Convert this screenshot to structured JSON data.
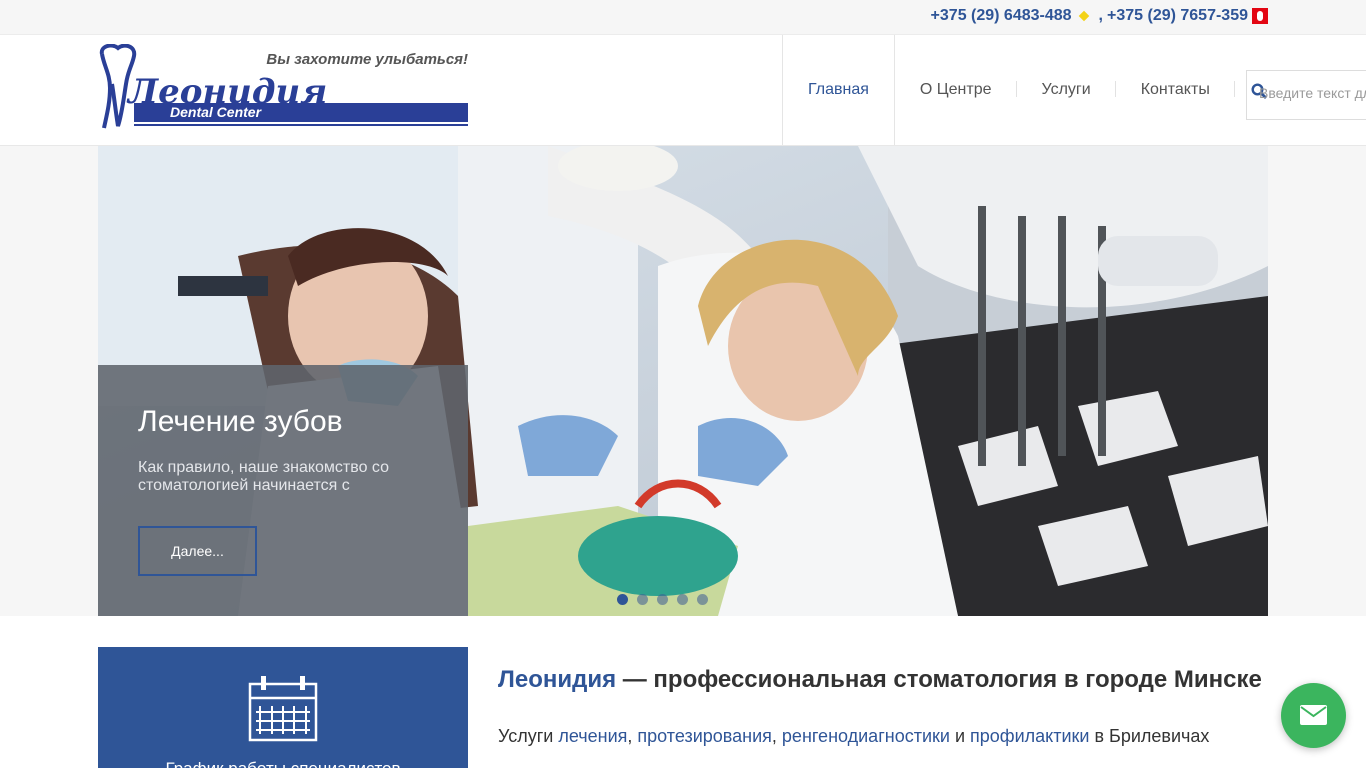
{
  "topbar": {
    "phone_1": "+375 (29) 6483-488",
    "separator": ",",
    "phone_2": "+375 (29) 7657-359",
    "operator_1_icon": "velcom-icon",
    "operator_2_icon": "mts-icon"
  },
  "logo": {
    "brand": "Леонидия",
    "subbrand": "Dental Center",
    "tagline": "Вы захотите улыбаться!",
    "brand_color": "#2a3f97"
  },
  "nav": {
    "items": [
      {
        "label": "Главная",
        "active": true
      },
      {
        "label": "О Центре",
        "active": false
      },
      {
        "label": "Услуги",
        "active": false
      },
      {
        "label": "Контакты",
        "active": false
      }
    ]
  },
  "search": {
    "placeholder": "Введите текст для поиска",
    "icon": "search-icon"
  },
  "slider": {
    "title": "Лечение зубов",
    "text": "Как правило, наше знакомство со стоматологией начинается с",
    "button_label": "Далее...",
    "slides_count": 5,
    "active_slide": 1
  },
  "schedule": {
    "label": "График работы специалистов",
    "icon": "calendar-icon"
  },
  "intro": {
    "heading_accent": "Леонидия",
    "heading_rest": " — профессиональная стоматология в городе Минске",
    "line_prefix": "Услуги ",
    "link_1": "лечения",
    "comma_1": ", ",
    "link_2": "протезирования",
    "comma_2": ", ",
    "link_3": "ренгенодиагностики",
    "and": " и ",
    "link_4": "профилактики",
    "line_suffix": " в Брилевичах"
  },
  "colors": {
    "accent": "#2f5597",
    "mail_button": "#3bb55e"
  },
  "mail_button": {
    "icon": "envelope-icon"
  }
}
